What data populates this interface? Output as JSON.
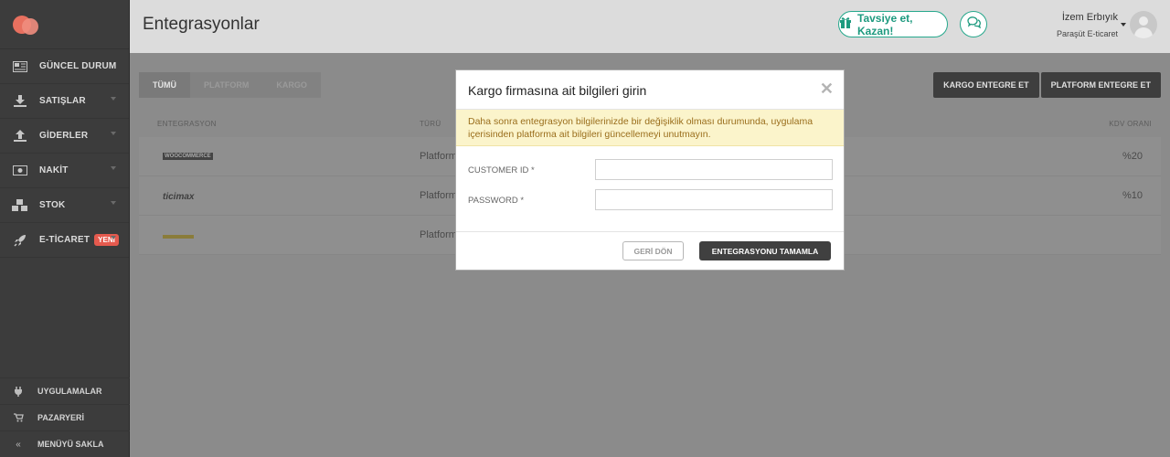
{
  "sidebar": {
    "items": [
      {
        "label": "GÜNCEL DURUM",
        "icon": "newspaper-icon"
      },
      {
        "label": "SATIŞLAR",
        "icon": "download-icon"
      },
      {
        "label": "GİDERLER",
        "icon": "upload-icon"
      },
      {
        "label": "NAKİT",
        "icon": "money-icon"
      },
      {
        "label": "STOK",
        "icon": "cubes-icon"
      },
      {
        "label": "E-TİCARET",
        "icon": "rocket-icon",
        "badge": "YENİ"
      }
    ],
    "bottom": [
      {
        "label": "UYGULAMALAR",
        "icon": "plug-icon"
      },
      {
        "label": "PAZARYERİ",
        "icon": "cart-icon"
      },
      {
        "label": "MENÜYÜ SAKLA",
        "icon": "double-chevron-left-icon"
      }
    ]
  },
  "header": {
    "title": "Entegrasyonlar",
    "refer_label": "Tavsiye et, Kazan!",
    "user_name": "İzem Erbıyık",
    "company": "Paraşüt E-ticaret"
  },
  "main": {
    "tabs": [
      "TÜMÜ",
      "PLATFORM",
      "KARGO"
    ],
    "actions": [
      "KARGO ENTEGRE ET",
      "PLATFORM ENTEGRE ET"
    ],
    "columns": {
      "integration": "ENTEGRASYON",
      "type": "TÜRÜ",
      "kdv": "KDV ORANI"
    },
    "rows": [
      {
        "logo": "WOOCOMMERCE",
        "type": "Platform",
        "kdv": "%20"
      },
      {
        "logo": "ticimax",
        "type": "Platform",
        "kdv": "%10"
      },
      {
        "logo": "",
        "type": "Platform",
        "kdv": ""
      }
    ]
  },
  "modal": {
    "title": "Kargo firmasına ait bilgileri girin",
    "warning": "Daha sonra entegrasyon bilgilerinizde bir değişiklik olması durumunda, uygulama içerisinden platforma ait bilgileri güncellemeyi unutmayın.",
    "fields": [
      {
        "label": "CUSTOMER ID *",
        "value": ""
      },
      {
        "label": "PASSWORD *",
        "value": ""
      }
    ],
    "back_label": "GERİ DÖN",
    "submit_label": "ENTEGRASYONU TAMAMLA"
  },
  "colors": {
    "brand": "#e8705f",
    "accent": "#26a88c",
    "sidebar": "#3c3c3c",
    "warning_bg": "#fbf4cb"
  }
}
